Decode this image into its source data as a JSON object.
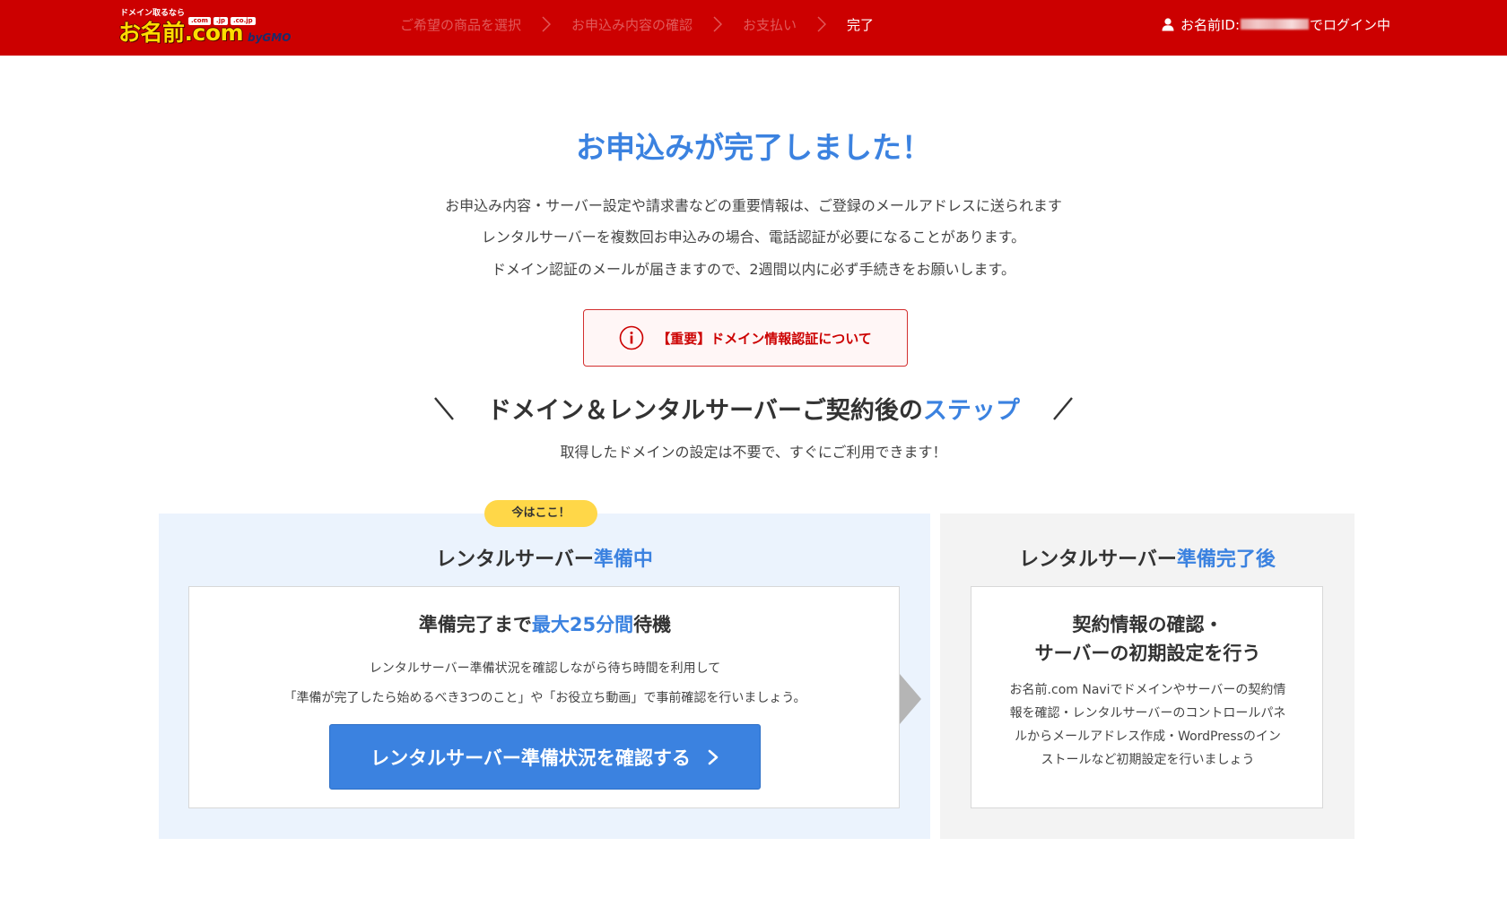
{
  "header": {
    "logo": {
      "tagline": "ドメイン取るなら",
      "tlds": [
        ".com",
        ".jp",
        ".co.jp"
      ],
      "name": "お名前.com",
      "by": "byGMO"
    },
    "steps": [
      {
        "label": "ご希望の商品を選択",
        "state": "inactive"
      },
      {
        "label": "お申込み内容の確認",
        "state": "inactive"
      },
      {
        "label": "お支払い",
        "state": "inactive"
      },
      {
        "label": "完了",
        "state": "active"
      }
    ],
    "login": {
      "prefix": "お名前ID:",
      "suffix": "でログイン中",
      "icon": "user-icon"
    }
  },
  "main": {
    "title": "お申込みが完了しました！",
    "intro": [
      "お申込み内容・サーバー設定や請求書などの重要情報は、ご登録のメールアドレスに送られます",
      "レンタルサーバーを複数回お申込みの場合、電話認証が必要になることがあります。",
      "ドメイン認証のメールが届きますので、2週間以内に必ず手続きをお願いします。"
    ],
    "notice": {
      "icon": "info-circle-icon",
      "text": "【重要】ドメイン情報認証について"
    },
    "steps_heading": {
      "text": "ドメイン＆レンタルサーバーご契約後の",
      "accent": "ステップ"
    },
    "steps_sub": "取得したドメインの設定は不要で、すぐにご利用できます！"
  },
  "panels": {
    "left": {
      "badge": "今はここ！",
      "title": "レンタルサーバー",
      "title_accent": "準備中",
      "card_title_pre": "準備完了まで",
      "card_title_accent": "最大25分間",
      "card_title_post": "待機",
      "text": [
        "レンタルサーバー準備状況を確認しながら待ち時間を利用して",
        "「準備が完了したら始めるべき3つのこと」や「お役立ち動画」で事前確認を行いましょう。"
      ],
      "cta": "レンタルサーバー準備状況を確認する"
    },
    "right": {
      "title": "レンタルサーバー",
      "title_accent": "準備完了後",
      "card_title": [
        "契約情報の確認・",
        "サーバーの初期設定を行う"
      ],
      "text": [
        "お名前.com Naviでドメインやサーバーの契約情",
        "報を確認・レンタルサーバーのコントロールパネ",
        "ルからメールアドレス作成・WordPressのイン",
        "ストールなど初期設定を行いましょう"
      ]
    }
  },
  "colors": {
    "header_red": "#cc0000",
    "accent_blue": "#3b82e0",
    "badge_yellow": "#ffd748",
    "left_panel_bg": "#ebf3fd",
    "right_panel_bg": "#f3f3f3"
  }
}
